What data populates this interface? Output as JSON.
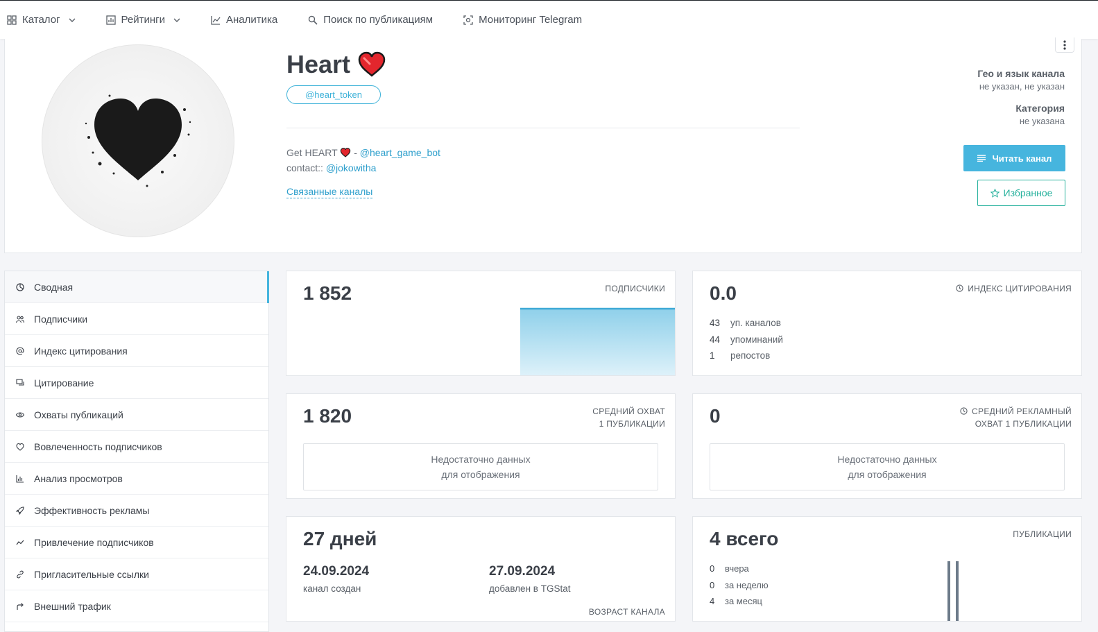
{
  "nav": {
    "items": [
      {
        "label": "Каталог",
        "icon": "grid-icon",
        "dropdown": true
      },
      {
        "label": "Рейтинги",
        "icon": "rating-icon",
        "dropdown": true
      },
      {
        "label": "Аналитика",
        "icon": "chart-line-icon",
        "dropdown": false
      },
      {
        "label": "Поиск по публикациям",
        "icon": "search-icon",
        "dropdown": false
      },
      {
        "label": "Мониторинг Telegram",
        "icon": "monitor-icon",
        "dropdown": false
      }
    ]
  },
  "channel": {
    "title": "Heart",
    "handle": "@heart_token",
    "desc_line1_prefix": "Get HEART",
    "desc_line1_sep": "-",
    "desc_line1_link": "@heart_game_bot",
    "desc_line2_prefix": "contact::",
    "desc_line2_link": "@jokowitha",
    "related_label": "Связанные каналы",
    "geo_label": "Гео и язык канала",
    "geo_value": "не указан, не указан",
    "category_label": "Категория",
    "category_value": "не указана",
    "read_button": "Читать канал",
    "fav_button": "Избранное"
  },
  "sidebar": {
    "items": [
      {
        "label": "Сводная",
        "icon": "summary-icon"
      },
      {
        "label": "Подписчики",
        "icon": "users-icon"
      },
      {
        "label": "Индекс цитирования",
        "icon": "at-icon"
      },
      {
        "label": "Цитирование",
        "icon": "quote-icon"
      },
      {
        "label": "Охваты публикаций",
        "icon": "eye-icon"
      },
      {
        "label": "Вовлеченность подписчиков",
        "icon": "engagement-icon"
      },
      {
        "label": "Анализ просмотров",
        "icon": "bar-chart-icon"
      },
      {
        "label": "Эффективность рекламы",
        "icon": "rocket-icon"
      },
      {
        "label": "Привлечение подписчиков",
        "icon": "trend-icon"
      },
      {
        "label": "Пригласительные ссылки",
        "icon": "link-icon"
      },
      {
        "label": "Внешний трафик",
        "icon": "external-icon"
      }
    ]
  },
  "stats": {
    "subscribers": {
      "value": "1 852",
      "caption": "ПОДПИСЧИКИ"
    },
    "citation": {
      "value": "0.0",
      "caption": "ИНДЕКС ЦИТИРОВАНИЯ",
      "rows": [
        {
          "n": "43",
          "label": "уп. каналов"
        },
        {
          "n": "44",
          "label": "упоминаний"
        },
        {
          "n": "1",
          "label": "репостов"
        }
      ]
    },
    "avg_reach": {
      "value": "1 820",
      "caption1": "СРЕДНИЙ ОХВАТ",
      "caption2": "1 ПУБЛИКАЦИИ",
      "nodata1": "Недостаточно данных",
      "nodata2": "для отображения"
    },
    "ad_reach": {
      "value": "0",
      "caption1": "СРЕДНИЙ РЕКЛАМНЫЙ",
      "caption2": "ОХВАТ 1 ПУБЛИКАЦИИ",
      "nodata1": "Недостаточно данных",
      "nodata2": "для отображения"
    },
    "age": {
      "value": "27 дней",
      "created_date": "24.09.2024",
      "created_label": "канал создан",
      "added_date": "27.09.2024",
      "added_label": "добавлен в TGStat",
      "caption": "ВОЗРАСТ КАНАЛА"
    },
    "posts": {
      "value": "4 всего",
      "caption": "ПУБЛИКАЦИИ",
      "rows": [
        {
          "n": "0",
          "label": "вчера"
        },
        {
          "n": "0",
          "label": "за неделю"
        },
        {
          "n": "4",
          "label": "за месяц"
        }
      ]
    }
  },
  "colors": {
    "accent": "#46b5de",
    "favorite": "#27b19d",
    "link": "#2e9fcc",
    "heart": "#e3262d"
  }
}
